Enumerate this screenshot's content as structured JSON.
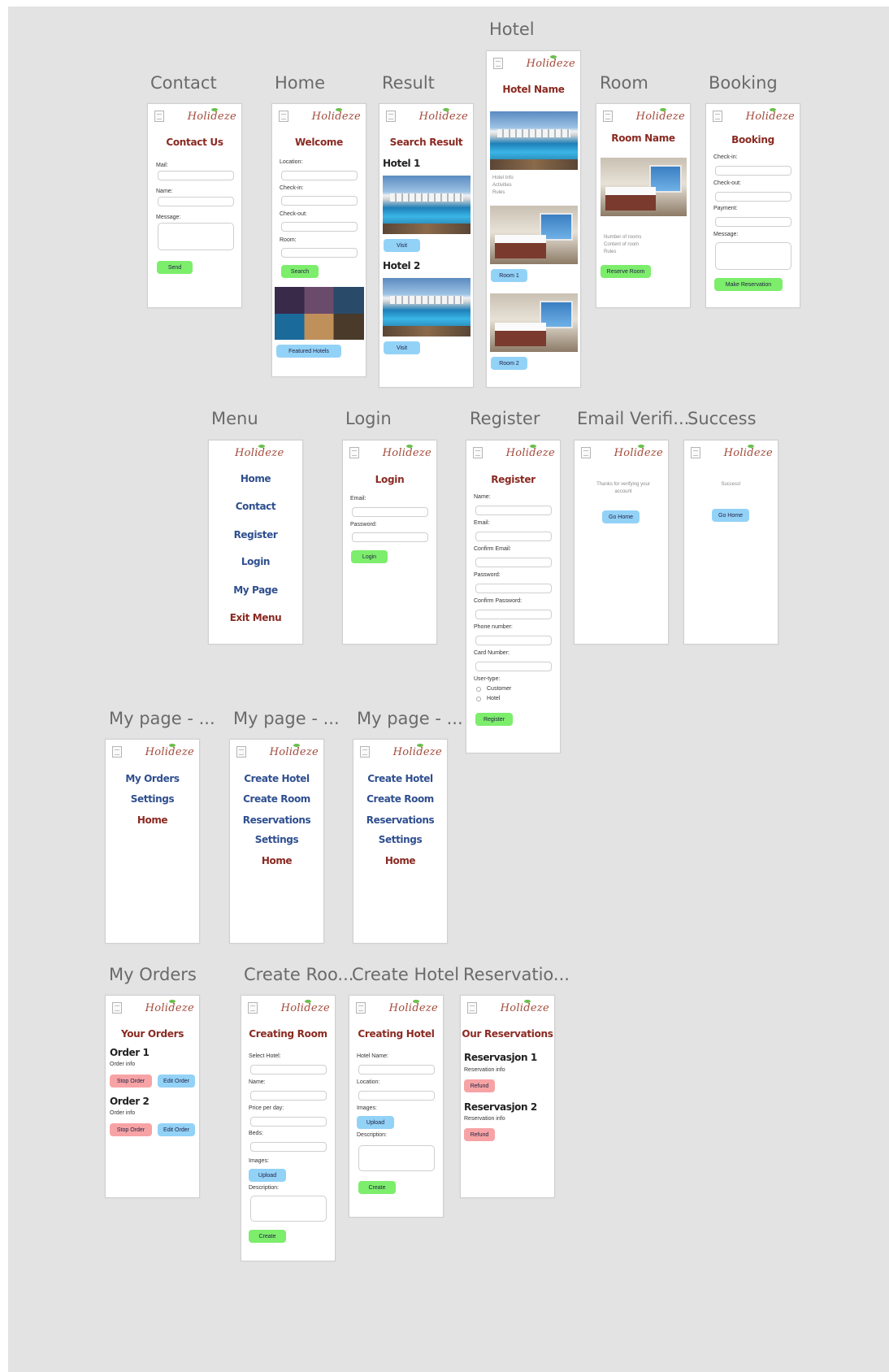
{
  "frames": {
    "contact": {
      "label": "Contact",
      "logo": "Holideze",
      "title": "Contact Us",
      "mail": "Mail:",
      "name": "Name:",
      "message": "Message:",
      "send": "Send"
    },
    "home": {
      "label": "Home",
      "logo": "Holideze",
      "title": "Welcome",
      "location": "Location:",
      "checkin": "Check-in:",
      "checkout": "Check-out:",
      "room": "Room:",
      "search": "Search",
      "featured": "Featured Hotels"
    },
    "result": {
      "label": "Result",
      "logo": "Holideze",
      "title": "Search Result",
      "hotel1": "Hotel 1",
      "hotel2": "Hotel 2",
      "visit": "Visit"
    },
    "hotel": {
      "label": "Hotel",
      "logo": "Holideze",
      "title": "Hotel Name",
      "info": [
        "Hotel Info",
        "Activities",
        "Rules"
      ],
      "room1": "Room 1",
      "room2": "Room 2"
    },
    "room": {
      "label": "Room",
      "logo": "Holideze",
      "title": "Room Name",
      "info": [
        "Number of rooms",
        "Content of room",
        "Rules"
      ],
      "reserve": "Reserve Room"
    },
    "booking": {
      "label": "Booking",
      "logo": "Holideze",
      "title": "Booking",
      "checkin": "Check-in:",
      "checkout": "Check-out:",
      "payment": "Payment:",
      "message": "Message:",
      "make": "Make Reservation"
    },
    "menu": {
      "label": "Menu",
      "logo": "Holideze",
      "items": [
        "Home",
        "Contact",
        "Register",
        "Login",
        "My Page"
      ],
      "exit": "Exit Menu"
    },
    "login": {
      "label": "Login",
      "logo": "Holideze",
      "title": "Login",
      "email": "Email:",
      "password": "Password:",
      "login": "Login"
    },
    "register": {
      "label": "Register",
      "logo": "Holideze",
      "title": "Register",
      "fields": [
        "Name:",
        "Email:",
        "Confirm Email:",
        "Password:",
        "Confirm Password:",
        "Phone number:",
        "Card Number:"
      ],
      "usertype": "User-type:",
      "customer": "Customer",
      "hotel": "Hotel",
      "register": "Register"
    },
    "email": {
      "label": "Email Verifi...",
      "logo": "Holideze",
      "text": "Thanks for verifying your account",
      "gohome": "Go Home"
    },
    "success": {
      "label": "Success",
      "logo": "Holideze",
      "text": "Success!",
      "gohome": "Go Home"
    },
    "mypage1": {
      "label": "My page - ...",
      "logo": "Holideze",
      "items": [
        "My Orders",
        "Settings"
      ],
      "home": "Home"
    },
    "mypage2": {
      "label": "My page - ...",
      "logo": "Holideze",
      "items": [
        "Create Hotel",
        "Create Room",
        "Reservations",
        "Settings"
      ],
      "home": "Home"
    },
    "mypage3": {
      "label": "My page - ...",
      "logo": "Holideze",
      "items": [
        "Create Hotel",
        "Create Room",
        "Reservations",
        "Settings"
      ],
      "home": "Home"
    },
    "orders": {
      "label": "My Orders",
      "logo": "Holideze",
      "title": "Your Orders",
      "order1": "Order 1",
      "order2": "Order 2",
      "info": "Order info",
      "stop": "Stop Order",
      "edit": "Edit Order"
    },
    "createroom": {
      "label": "Create Roo...",
      "logo": "Holideze",
      "title": "Creating Room",
      "select": "Select Hotel:",
      "name": "Name:",
      "price": "Price per day:",
      "beds": "Beds:",
      "images": "Images:",
      "upload": "Upload",
      "description": "Description:",
      "create": "Create"
    },
    "createhotel": {
      "label": "Create Hotel",
      "logo": "Holideze",
      "title": "Creating Hotel",
      "name": "Hotel Name:",
      "location": "Location:",
      "images": "Images:",
      "upload": "Upload",
      "description": "Description:",
      "create": "Create"
    },
    "reservations": {
      "label": "Reservatio...",
      "logo": "Holideze",
      "title": "Our Reservations",
      "res1": "Reservasjon 1",
      "res2": "Reservasjon 2",
      "info": "Reservation info",
      "refund": "Refund"
    }
  }
}
